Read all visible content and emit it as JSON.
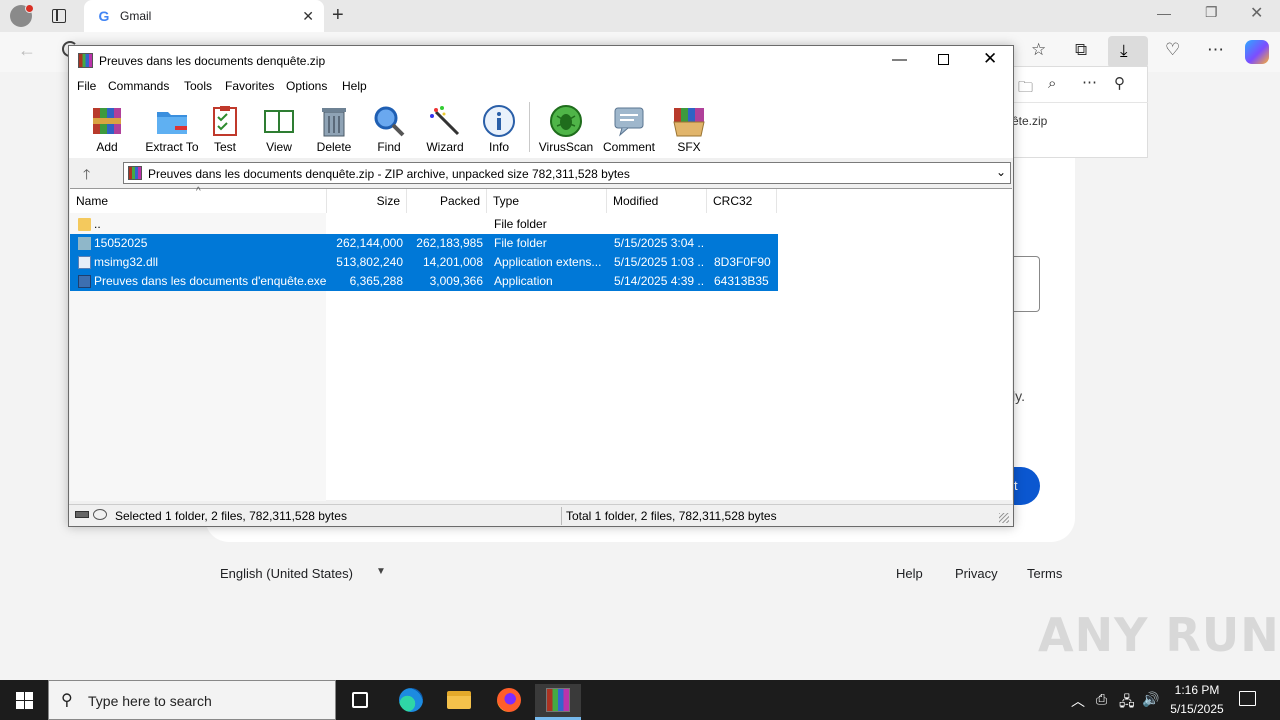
{
  "browser": {
    "tab_title": "Gmail",
    "tab_favicon": "G"
  },
  "downloads": {
    "filename_fragment": "ête.zip"
  },
  "gmail": {
    "text_fragment": "ly.",
    "next_fragment": "t",
    "footer": {
      "language": "English (United States)",
      "help": "Help",
      "privacy": "Privacy",
      "terms": "Terms"
    }
  },
  "watermark": "ANY RUN",
  "winrar": {
    "title": "Preuves dans les documents denquête.zip",
    "menu": [
      "File",
      "Commands",
      "Tools",
      "Favorites",
      "Options",
      "Help"
    ],
    "toolbar": [
      {
        "label": "Add",
        "icon": "add-archive-icon"
      },
      {
        "label": "Extract To",
        "icon": "extract-folder-icon"
      },
      {
        "label": "Test",
        "icon": "test-clipboard-icon"
      },
      {
        "label": "View",
        "icon": "view-book-icon"
      },
      {
        "label": "Delete",
        "icon": "delete-bin-icon"
      },
      {
        "label": "Find",
        "icon": "find-magnifier-icon"
      },
      {
        "label": "Wizard",
        "icon": "wizard-wand-icon"
      },
      {
        "label": "Info",
        "icon": "info-icon"
      },
      {
        "label": "VirusScan",
        "icon": "virusscan-bug-icon"
      },
      {
        "label": "Comment",
        "icon": "comment-icon"
      },
      {
        "label": "SFX",
        "icon": "sfx-box-icon"
      }
    ],
    "address": "Preuves dans les documents denquête.zip - ZIP archive, unpacked size 782,311,528 bytes",
    "columns": [
      "Name",
      "Size",
      "Packed",
      "Type",
      "Modified",
      "CRC32"
    ],
    "rows": [
      {
        "name": "..",
        "size": "",
        "packed": "",
        "type": "File folder",
        "modified": "",
        "crc": "",
        "selected": false,
        "icon": "parent-folder-icon"
      },
      {
        "name": "15052025",
        "size": "262,144,000",
        "packed": "262,183,985",
        "type": "File folder",
        "modified": "5/15/2025 3:04 ...",
        "crc": "",
        "selected": true,
        "icon": "folder-icon"
      },
      {
        "name": "msimg32.dll",
        "size": "513,802,240",
        "packed": "14,201,008",
        "type": "Application extens...",
        "modified": "5/15/2025 1:03 ...",
        "crc": "8D3F0F90",
        "selected": true,
        "icon": "dll-file-icon"
      },
      {
        "name": "Preuves dans les documents d'enquête.exe",
        "size": "6,365,288",
        "packed": "3,009,366",
        "type": "Application",
        "modified": "5/14/2025 4:39 ...",
        "crc": "64313B35",
        "selected": true,
        "icon": "exe-file-icon"
      }
    ],
    "status_left": "Selected 1 folder, 2 files, 782,311,528 bytes",
    "status_right": "Total 1 folder, 2 files, 782,311,528 bytes"
  },
  "taskbar": {
    "search_placeholder": "Type here to search",
    "time": "1:16 PM",
    "date": "5/15/2025"
  }
}
